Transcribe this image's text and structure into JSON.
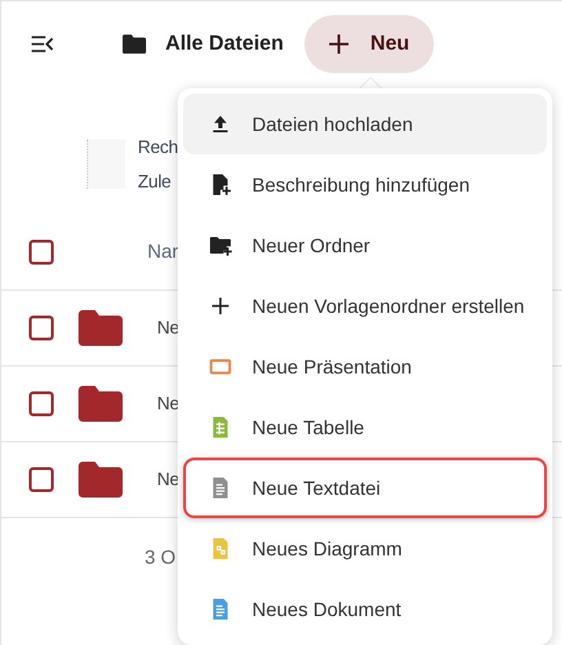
{
  "toolbar": {
    "breadcrumb": "Alle Dateien",
    "new_button": "Neu"
  },
  "description": {
    "line_1": "Rech",
    "line_2": "Zule"
  },
  "table": {
    "header": {
      "label": "Nar",
      "checked": false
    },
    "rows": [
      {
        "name": "Ne",
        "checked": false
      },
      {
        "name": "Ne",
        "checked": false
      },
      {
        "name": "Ne",
        "checked": false
      }
    ],
    "summary": "3 O"
  },
  "menu": {
    "items": [
      {
        "kind": "upload",
        "label": "Dateien hochladen",
        "hovered": true,
        "highlighted": false
      },
      {
        "kind": "description",
        "label": "Beschreibung hinzufügen",
        "hovered": false,
        "highlighted": false
      },
      {
        "kind": "folder",
        "label": "Neuer Ordner",
        "hovered": false,
        "highlighted": false
      },
      {
        "kind": "plus",
        "label": "Neuen Vorlagenordner erstellen",
        "hovered": false,
        "highlighted": false
      },
      {
        "kind": "presentation",
        "label": "Neue Präsentation",
        "hovered": false,
        "highlighted": false
      },
      {
        "kind": "spreadsheet",
        "label": "Neue Tabelle",
        "hovered": false,
        "highlighted": false
      },
      {
        "kind": "text",
        "label": "Neue Textdatei",
        "hovered": false,
        "highlighted": true
      },
      {
        "kind": "diagram",
        "label": "Neues Diagramm",
        "hovered": false,
        "highlighted": false
      },
      {
        "kind": "document",
        "label": "Neues Dokument",
        "hovered": false,
        "highlighted": false
      }
    ]
  }
}
